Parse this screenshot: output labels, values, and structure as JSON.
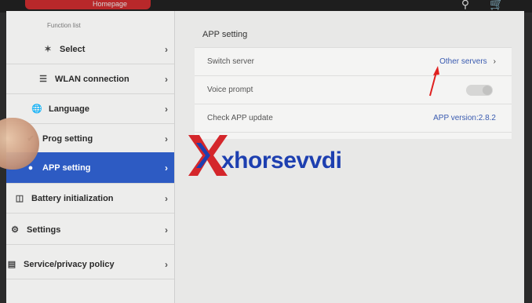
{
  "topbar": {
    "home_label": "Homepage",
    "search_icon": "search-icon",
    "cart_icon": "cart-icon"
  },
  "sidebar": {
    "section_title": "Function list",
    "items": [
      {
        "label": "Select",
        "icon": "bluetooth-icon"
      },
      {
        "label": "WLAN connection",
        "icon": "wifi-icon"
      },
      {
        "label": "Language",
        "icon": "globe-icon"
      },
      {
        "label": "Prog setting",
        "icon": "wrench-icon"
      },
      {
        "label": "APP setting",
        "icon": "app-icon",
        "active": true
      },
      {
        "label": "Battery initialization",
        "icon": "battery-icon"
      },
      {
        "label": "Settings",
        "icon": "gear-icon"
      },
      {
        "label": "Service/privacy policy",
        "icon": "document-icon"
      }
    ]
  },
  "content": {
    "title": "APP setting",
    "rows": [
      {
        "label": "Switch server",
        "value": "Other servers"
      },
      {
        "label": "Voice prompt",
        "toggle_on": false
      },
      {
        "label": "Check APP update",
        "value": "APP version:2.8.2"
      }
    ]
  },
  "watermark": {
    "text": "xhorsevvdi"
  },
  "colors": {
    "accent": "#2d5bc3",
    "link": "#3a5bb0",
    "brand_red": "#d4262b",
    "brand_blue": "#1d3fb0"
  }
}
